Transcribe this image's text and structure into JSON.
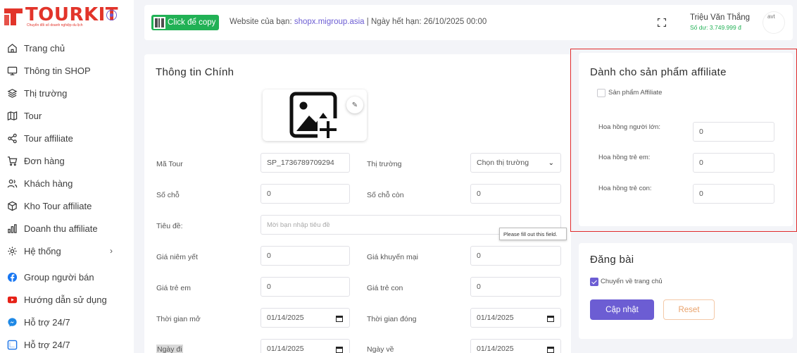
{
  "brand": {
    "name": "TOURKIT",
    "tagline": "Chuyển đổi số doanh nghiệp du lịch",
    "color": "#e2342a"
  },
  "accent": "#6c5dd3",
  "sidebar": {
    "items": [
      {
        "label": "Trang chủ",
        "icon": "home-icon"
      },
      {
        "label": "Thông tin SHOP",
        "icon": "monitor-icon"
      },
      {
        "label": "Thị trường",
        "icon": "layers-icon"
      },
      {
        "label": "Tour",
        "icon": "map-icon"
      },
      {
        "label": "Tour affiliate",
        "icon": "share-icon"
      },
      {
        "label": "Đơn hàng",
        "icon": "cart-icon"
      },
      {
        "label": "Khách hàng",
        "icon": "users-icon"
      },
      {
        "label": "Kho Tour affiliate",
        "icon": "box-icon"
      },
      {
        "label": "Doanh thu affiliate",
        "icon": "bar-chart-icon"
      },
      {
        "label": "Hệ thống",
        "icon": "settings-icon",
        "chevron": "›"
      },
      {
        "label": "Group người bán",
        "icon": "facebook-icon"
      },
      {
        "label": "Hướng dẫn sử dụng",
        "icon": "youtube-icon"
      },
      {
        "label": "Hỗ trợ 24/7",
        "icon": "messenger-icon"
      },
      {
        "label": "Hỗ trợ 24/7",
        "icon": "zalo-icon"
      }
    ]
  },
  "header": {
    "copy_label": "Click để copy",
    "site_prefix": "Website của bạn: ",
    "site_url": "shopx.migroup.asia",
    "expiry": " | Ngày hết hạn: 26/10/2025 00:00",
    "user_name": "Triệu Văn Thắng",
    "balance": "Số dư: 3.749.999 đ",
    "avatar_alt": "avt"
  },
  "main": {
    "title": "Thông tin Chính",
    "fields": {
      "ma_tour_label": "Mã Tour",
      "ma_tour_value": "SP_1736789709294",
      "thi_truong_label": "Thị trường",
      "thi_truong_value": "Chọn thị trường",
      "so_cho_label": "Số chỗ",
      "so_cho_value": "0",
      "so_cho_con_label": "Số chỗ còn",
      "so_cho_con_value": "0",
      "tieu_de_label": "Tiêu đề:",
      "tieu_de_placeholder": "Mời bạn nhập tiêu đề",
      "gia_niem_yet_label": "Giá niêm yết",
      "gia_niem_yet_value": "0",
      "gia_khuyen_mai_label": "Giá khuyến mại",
      "gia_khuyen_mai_value": "0",
      "gia_tre_em_label": "Giá trẻ em",
      "gia_tre_em_value": "0",
      "gia_tre_con_label": "Giá trẻ con",
      "gia_tre_con_value": "0",
      "thoi_gian_mo_label": "Thời gian mở",
      "thoi_gian_mo_value": "01/14/2025",
      "thoi_gian_dong_label": "Thời gian đóng",
      "thoi_gian_dong_value": "01/14/2025",
      "ngay_di_label": "Ngày đi",
      "ngay_di_value": "01/14/2025",
      "ngay_ve_label": "Ngày về",
      "ngay_ve_value": "01/14/2025"
    },
    "tooltip": "Please fill out this field."
  },
  "affiliate": {
    "title": "Dành cho sản phẩm affiliate",
    "checkbox_label": "Sản phẩm Affiliate",
    "checked": false,
    "hoa_hong_nguoi_lon_label": "Hoa hồng người lớn:",
    "hoa_hong_nguoi_lon_value": "0",
    "hoa_hong_tre_em_label": "Hoa hồng trẻ em:",
    "hoa_hong_tre_em_value": "0",
    "hoa_hong_tre_con_label": "Hoa hồng trẻ con:",
    "hoa_hong_tre_con_value": "0"
  },
  "post": {
    "title": "Đăng bài",
    "checkbox_label": "Chuyển về trang chủ",
    "checked": true,
    "update_label": "Cập nhật",
    "reset_label": "Reset"
  }
}
